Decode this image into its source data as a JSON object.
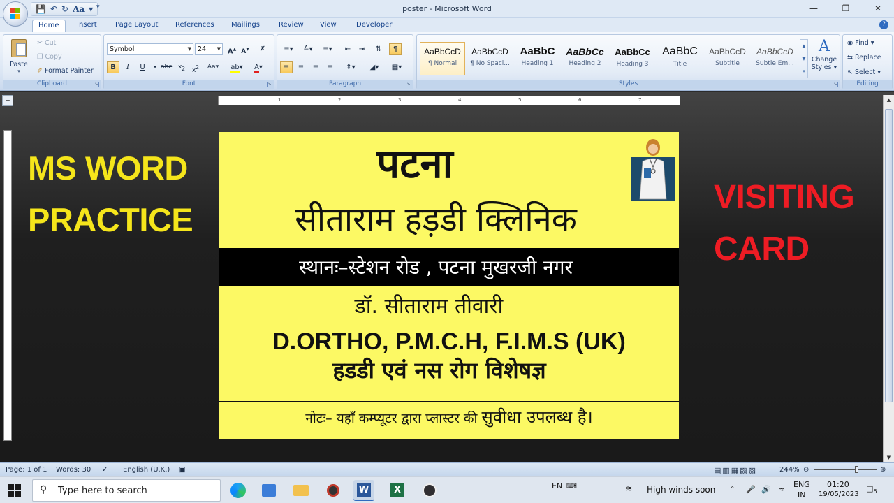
{
  "window": {
    "title": "poster - Microsoft Word",
    "qat_font_btn": "Aa",
    "controls": [
      "—",
      "❐",
      "✕"
    ]
  },
  "tabs": [
    "Home",
    "Insert",
    "Page Layout",
    "References",
    "Mailings",
    "Review",
    "View",
    "Developer"
  ],
  "ribbon": {
    "clipboard": {
      "paste": "Paste",
      "cut": "Cut",
      "copy": "Copy",
      "format_painter": "Format Painter",
      "label": "Clipboard"
    },
    "font": {
      "name": "Symbol",
      "size": "24",
      "label": "Font"
    },
    "paragraph": {
      "label": "Paragraph"
    },
    "styles": {
      "label": "Styles",
      "items": [
        {
          "preview": "AaBbCcD",
          "name": "¶ Normal"
        },
        {
          "preview": "AaBbCcD",
          "name": "¶ No Spaci..."
        },
        {
          "preview": "AaBbC",
          "name": "Heading 1"
        },
        {
          "preview": "AaBbCc",
          "name": "Heading 2"
        },
        {
          "preview": "AaBbCc",
          "name": "Heading 3"
        },
        {
          "preview": "AaBbC",
          "name": "Title"
        },
        {
          "preview": "AaBbCcD",
          "name": "Subtitle"
        },
        {
          "preview": "AaBbCcD",
          "name": "Subtle Em..."
        }
      ],
      "change_styles": [
        "Change",
        "Styles ▾"
      ]
    },
    "editing": {
      "find": "Find ▾",
      "replace": "Replace",
      "select": "Select ▾",
      "label": "Editing"
    }
  },
  "ruler": {
    "numbers": [
      "1",
      "2",
      "3",
      "4",
      "5",
      "6",
      "7"
    ]
  },
  "overlay": {
    "left": [
      "MS WORD",
      "PRACTICE"
    ],
    "right": [
      "VISITING",
      "CARD"
    ]
  },
  "card": {
    "city": "पटना",
    "clinic": "सीताराम हड़डी क्लिनिक",
    "address": "स्थानः–स्टेशन रोड , पटना मुखरजी नगर",
    "doctor": "डॉ. सीताराम तीवारी",
    "degree": "D.ORTHO, P.M.C.H, F.I.M.S  (UK)",
    "specialty": "हडडी एवं नस रोग विशेषज्ञ",
    "note_prefix": "नोटः– यहाँ कम्प्यूटर द्वारा प्लास्टर की ",
    "note_suffix": "सुवीधा उपलब्ध है।"
  },
  "status": {
    "page": "Page: 1 of 1",
    "words": "Words: 30",
    "language": "English (U.K.)",
    "zoom": "244%"
  },
  "taskbar": {
    "search_placeholder": "Type here to search",
    "ime": "EN",
    "weather": "High winds soon",
    "lang_top": "ENG",
    "lang_bottom": "IN",
    "time": "01:20",
    "date": "19/05/2023",
    "notif_count": "6"
  }
}
